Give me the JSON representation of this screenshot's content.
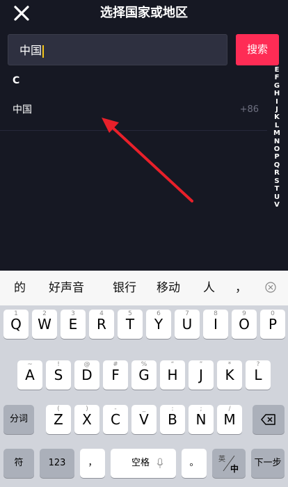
{
  "header": {
    "title": "选择国家或地区",
    "close_icon": "close-icon"
  },
  "search": {
    "value": "中国",
    "button_label": "搜索"
  },
  "list": {
    "section_letter": "C",
    "rows": [
      {
        "name": "中国",
        "code": "+86"
      }
    ]
  },
  "index_letters": [
    "E",
    "F",
    "G",
    "H",
    "I",
    "J",
    "K",
    "L",
    "M",
    "N",
    "O",
    "P",
    "Q",
    "R",
    "S",
    "T",
    "U",
    "V"
  ],
  "annotation": {
    "arrow_color": "#e8202a"
  },
  "keyboard": {
    "candidates": [
      "的",
      "好声音",
      "银行",
      "移动",
      "人",
      "，"
    ],
    "row1": [
      {
        "main": "Q",
        "sub": "1"
      },
      {
        "main": "W",
        "sub": "2"
      },
      {
        "main": "E",
        "sub": "3"
      },
      {
        "main": "R",
        "sub": "4"
      },
      {
        "main": "T",
        "sub": "5"
      },
      {
        "main": "Y",
        "sub": "6"
      },
      {
        "main": "U",
        "sub": "7"
      },
      {
        "main": "I",
        "sub": "8"
      },
      {
        "main": "O",
        "sub": "9"
      },
      {
        "main": "P",
        "sub": "0"
      }
    ],
    "row2": [
      {
        "main": "A",
        "sub": "~"
      },
      {
        "main": "S",
        "sub": "!"
      },
      {
        "main": "D",
        "sub": "@"
      },
      {
        "main": "F",
        "sub": "#"
      },
      {
        "main": "G",
        "sub": "%"
      },
      {
        "main": "H",
        "sub": "“"
      },
      {
        "main": "J",
        "sub": "”"
      },
      {
        "main": "K",
        "sub": "*"
      },
      {
        "main": "L",
        "sub": "?"
      }
    ],
    "row3": [
      {
        "main": "Z",
        "sub": "("
      },
      {
        "main": "X",
        "sub": ")"
      },
      {
        "main": "C",
        "sub": "-"
      },
      {
        "main": "V",
        "sub": "_"
      },
      {
        "main": "B",
        "sub": ":"
      },
      {
        "main": "N",
        "sub": ";"
      },
      {
        "main": "M",
        "sub": "/"
      }
    ],
    "fenci_label": "分词",
    "backspace_icon": "backspace-icon",
    "symbol_label": "符",
    "num_label": "123",
    "comma_label": "，",
    "space_label": "空格",
    "mic_icon": "mic-icon",
    "period_label": "。",
    "lang_en_label": "英",
    "lang_zh_label": "中",
    "next_label": "下一步"
  },
  "colors": {
    "accent": "#fe2c55",
    "background": "#161823"
  }
}
